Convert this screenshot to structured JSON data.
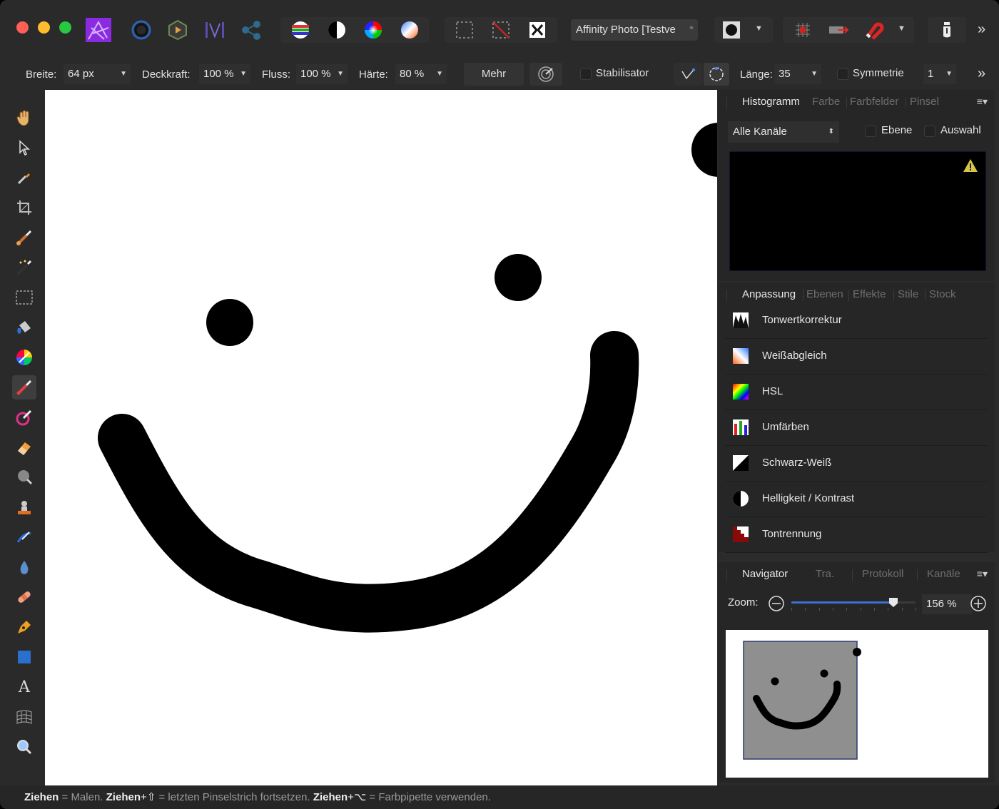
{
  "app": {
    "document_title": "Affinity Photo [Testve",
    "document_modified_mark": "*"
  },
  "context_toolbar": {
    "width_label": "Breite:",
    "width_value": "64 px",
    "opacity_label": "Deckkraft:",
    "opacity_value": "100 %",
    "flow_label": "Fluss:",
    "flow_value": "100 %",
    "hardness_label": "Härte:",
    "hardness_value": "80 %",
    "more_label": "Mehr",
    "stabilizer_label": "Stabilisator",
    "length_label": "Länge:",
    "length_value": "35",
    "symmetry_label": "Symmetrie",
    "symmetry_value": "1"
  },
  "histogram_panel": {
    "tabs": [
      "Histogramm",
      "Farbe",
      "Farbfelder",
      "Pinsel"
    ],
    "channel_select": "Alle Kanäle",
    "layer_label": "Ebene",
    "selection_label": "Auswahl"
  },
  "adjustment_panel": {
    "tabs": [
      "Anpassung",
      "Ebenen",
      "Effekte",
      "Stile",
      "Stock"
    ],
    "items": [
      {
        "label": "Tonwertkorrektur",
        "icon": "levels-icon"
      },
      {
        "label": "Weißabgleich",
        "icon": "white-balance-icon"
      },
      {
        "label": "HSL",
        "icon": "hsl-icon"
      },
      {
        "label": "Umfärben",
        "icon": "recolor-icon"
      },
      {
        "label": "Schwarz-Weiß",
        "icon": "black-white-icon"
      },
      {
        "label": "Helligkeit / Kontrast",
        "icon": "brightness-contrast-icon"
      },
      {
        "label": "Tontrennung",
        "icon": "posterize-icon"
      }
    ]
  },
  "navigator_panel": {
    "tabs": [
      "Navigator",
      "Tra.",
      "Protokoll",
      "Kanäle"
    ],
    "zoom_label": "Zoom:",
    "zoom_value": "156 %",
    "zoom_slider_fraction": 0.82
  },
  "status_bar": {
    "part1_bold": "Ziehen",
    "part1_text": " = Malen. ",
    "part2_bold": "Ziehen",
    "part2_mod": "+⇧",
    "part2_text": " = letzten Pinselstrich fortsetzen. ",
    "part3_bold": "Ziehen",
    "part3_mod": "+⌥",
    "part3_text": " = Farbpipette verwenden."
  }
}
